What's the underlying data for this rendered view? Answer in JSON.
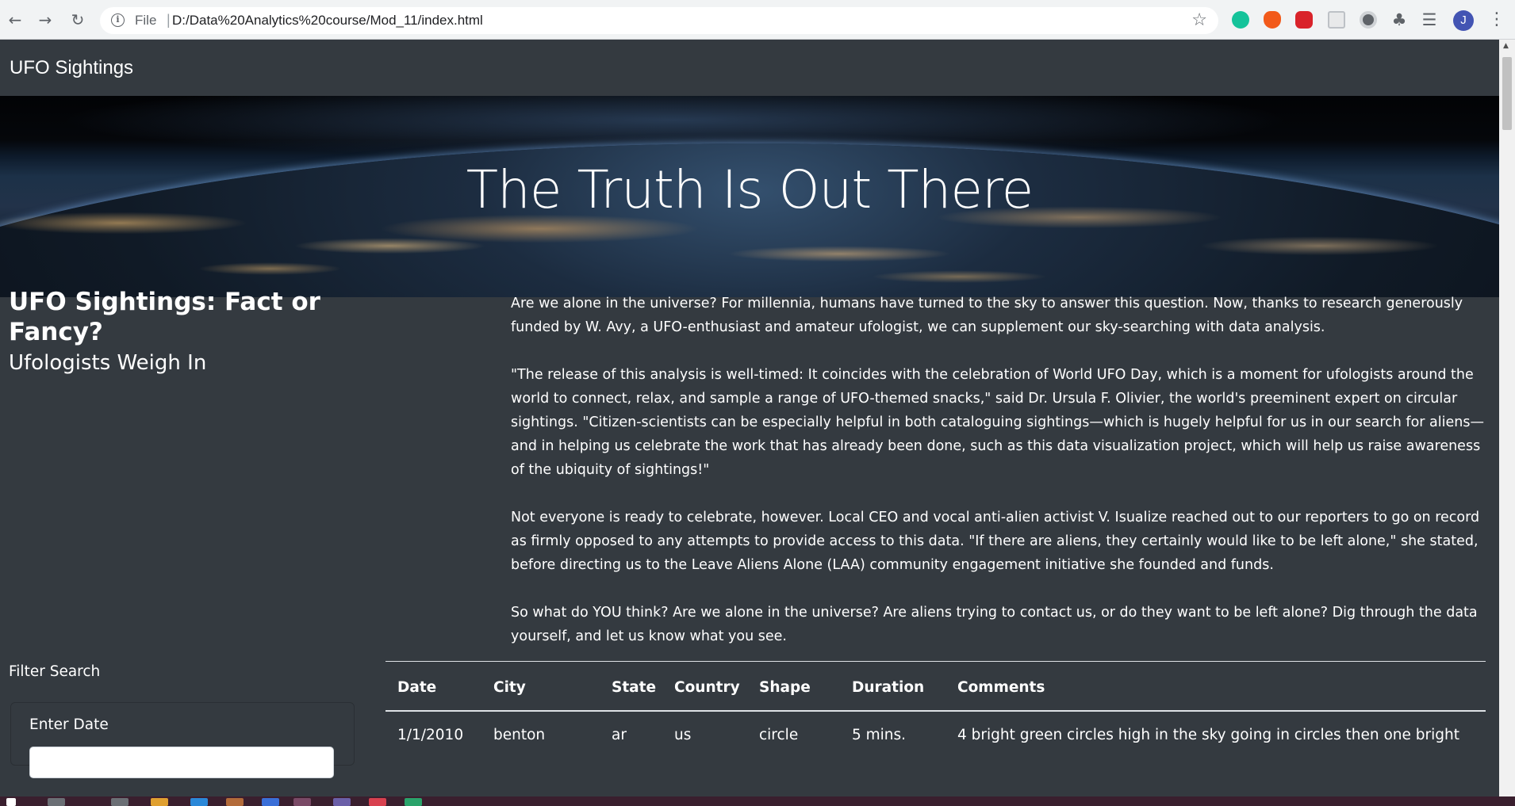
{
  "browser": {
    "scheme_label": "File",
    "url": "D:/Data%20Analytics%20course/Mod_11/index.html",
    "profile_initial": "J",
    "icons": [
      "back-arrow-icon",
      "forward-arrow-icon",
      "reload-icon",
      "info-icon",
      "star-icon",
      "grammarly-icon",
      "fire-icon",
      "shield-icon",
      "document-icon",
      "circle-icon",
      "puzzle-icon",
      "media-control-icon",
      "menu-kebab-icon"
    ]
  },
  "navbar": {
    "brand": "UFO Sightings"
  },
  "hero": {
    "title": "The Truth Is Out There"
  },
  "sidebar": {
    "heading": "UFO Sightings: Fact or Fancy?",
    "subheading": "Ufologists Weigh In",
    "filter_title": "Filter Search",
    "date_label": "Enter Date"
  },
  "article": {
    "p1": "Are we alone in the universe? For millennia, humans have turned to the sky to answer this question. Now, thanks to research generously funded by W. Avy, a UFO-enthusiast and amateur ufologist, we can supplement our sky-searching with data analysis.",
    "p2": "\"The release of this analysis is well-timed: It coincides with the celebration of World UFO Day, which is a moment for ufologists around the world to connect, relax, and sample a range of UFO-themed snacks,\" said Dr. Ursula F. Olivier, the world's preeminent expert on circular sightings. \"Citizen-scientists can be especially helpful in both cataloguing sightings—which is hugely helpful for us in our search for aliens—and in helping us celebrate the work that has already been done, such as this data visualization project, which will help us raise awareness of the ubiquity of sightings!\"",
    "p3": "Not everyone is ready to celebrate, however. Local CEO and vocal anti-alien activist V. Isualize reached out to our reporters to go on record as firmly opposed to any attempts to provide access to this data. \"If there are aliens, they certainly would like to be left alone,\" she stated, before directing us to the Leave Aliens Alone (LAA) community engagement initiative she founded and funds.",
    "p4": "So what do YOU think? Are we alone in the universe? Are aliens trying to contact us, or do they want to be left alone? Dig through the data yourself, and let us know what you see."
  },
  "table": {
    "headers": [
      "Date",
      "City",
      "State",
      "Country",
      "Shape",
      "Duration",
      "Comments"
    ],
    "rows": [
      [
        "1/1/2010",
        "benton",
        "ar",
        "us",
        "circle",
        "5 mins.",
        "4 bright green circles high in the sky going in circles then one bright"
      ]
    ]
  },
  "colors": {
    "page_bg": "#343a40",
    "text": "#ffffff",
    "chrome_bg": "#f1f3f4"
  }
}
